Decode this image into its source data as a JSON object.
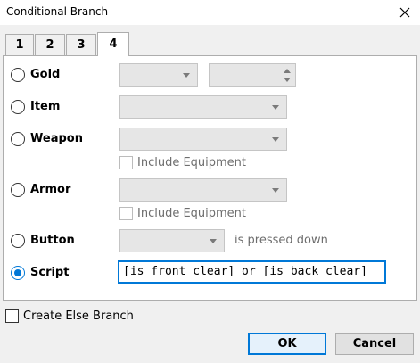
{
  "window": {
    "title": "Conditional Branch"
  },
  "tabs": [
    {
      "label": "1"
    },
    {
      "label": "2"
    },
    {
      "label": "3"
    },
    {
      "label": "4"
    }
  ],
  "active_tab": "4",
  "conditions": {
    "gold": {
      "label": "Gold"
    },
    "item": {
      "label": "Item"
    },
    "weapon": {
      "label": "Weapon",
      "include_equipment": "Include Equipment"
    },
    "armor": {
      "label": "Armor",
      "include_equipment": "Include Equipment"
    },
    "button": {
      "label": "Button",
      "suffix": "is pressed down"
    },
    "script": {
      "label": "Script",
      "value": "[is front clear] or [is back clear]",
      "selected": true
    }
  },
  "else_branch": {
    "label": "Create Else Branch",
    "checked": false
  },
  "buttons": {
    "ok": "OK",
    "cancel": "Cancel"
  },
  "colors": {
    "accent": "#0078d7",
    "disabled_field": "#e6e6e6",
    "disabled_text": "#6d6d6d"
  },
  "icons": {
    "close": "close-icon",
    "dropdown": "chevron-down-icon"
  }
}
